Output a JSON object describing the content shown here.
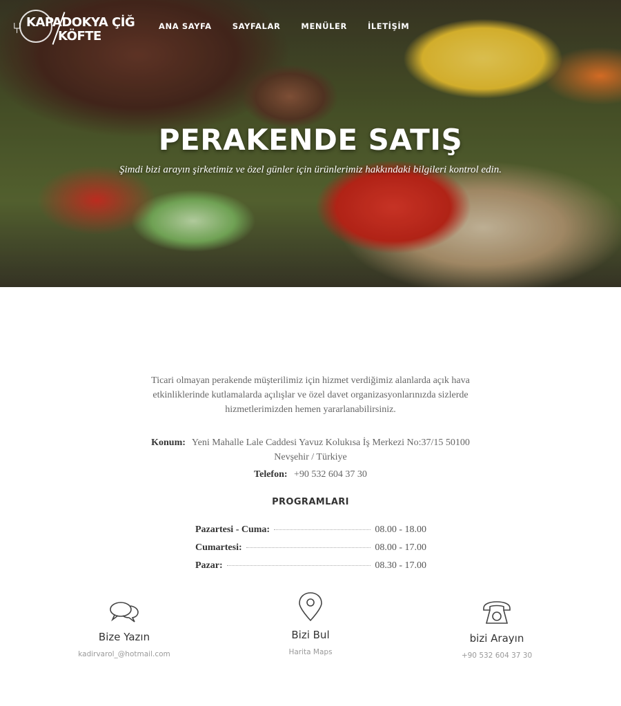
{
  "header": {
    "logo": {
      "line1": "KAPADOKYA ÇİĞ",
      "line2": "KÖFTE"
    },
    "nav": [
      {
        "label": "ANA SAYFA"
      },
      {
        "label": "SAYFALAR"
      },
      {
        "label": "MENÜLER"
      },
      {
        "label": "İLETİŞİM"
      }
    ]
  },
  "hero": {
    "title": "PERAKENDE SATIŞ",
    "subtitle": "Şimdi bizi arayın şirketimiz ve özel günler için ürünlerimiz hakkındaki bilgileri kontrol edin."
  },
  "content": {
    "intro_lines": [
      "Ticari olmayan perakende müşterilimiz için hizmet verdiğimiz alanlarda açık hava",
      "etkinliklerinde kutlamalarda açılışlar ve özel davet organizasyonlarınızda sizlerde",
      "hizmetlerimizden hemen yararlanabilirsiniz."
    ],
    "location_label": "Konum:",
    "location_value": "Yeni Mahalle Lale Caddesi Yavuz Kolukısa İş Merkezi No:37/15 50100",
    "location_value2": "Nevşehir / Türkiye",
    "phone_label": "Telefon:",
    "phone_value": "+90 532 604 37 30",
    "programs_title": "PROGRAMLARI",
    "schedule": [
      {
        "day": "Pazartesi - Cuma:",
        "time": "08.00 - 18.00"
      },
      {
        "day": "Cumartesi:",
        "time": "08.00 - 17.00"
      },
      {
        "day": "Pazar:",
        "time": "08.30 - 17.00"
      }
    ]
  },
  "features": [
    {
      "icon": "chat-bubbles-icon",
      "title": "Bize Yazın",
      "subtitle": "kadirvarol_@hotmail.com"
    },
    {
      "icon": "map-pin-icon",
      "title": "Bizi Bul",
      "subtitle": "Harita Maps"
    },
    {
      "icon": "telephone-icon",
      "title": "bizi Arayın",
      "subtitle": "+90 532 604 37 30"
    }
  ]
}
